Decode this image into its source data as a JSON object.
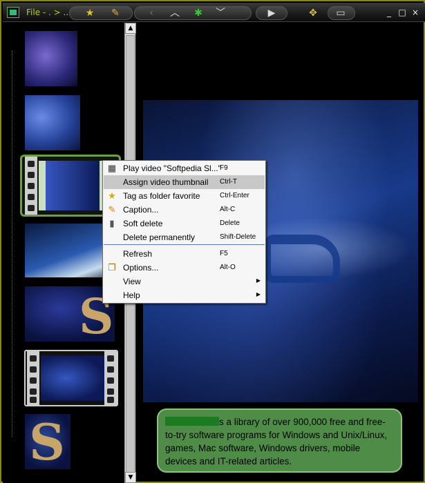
{
  "window": {
    "title": "File - . > ..."
  },
  "toolbar": {
    "star_icon": "star-icon",
    "pencil_icon": "pencil-icon",
    "back_icon": "chevron-left-icon",
    "up_icon": "chevron-up-icon",
    "bug_icon": "bug-icon",
    "down_icon": "chevron-down-icon",
    "play_icon": "play-icon",
    "move_icon": "move-icon",
    "toggle_icon": "toggle-icon"
  },
  "window_controls": {
    "minimize": "_",
    "maximize": "□",
    "close": "×"
  },
  "scrollbar": {
    "up": "▲",
    "down": "▼"
  },
  "context_menu": {
    "items": [
      {
        "label": "Play video \"Softpedia Sl...\"",
        "shortcut": "F9",
        "icon": "film-icon"
      },
      {
        "label": "Assign video thumbnail",
        "shortcut": "Ctrl-T",
        "icon": ""
      },
      {
        "label": "Tag as folder favorite",
        "shortcut": "Ctrl-Enter",
        "icon": "star-icon"
      },
      {
        "label": "Caption...",
        "shortcut": "Alt-C",
        "icon": "pencil-icon"
      },
      {
        "label": "Soft delete",
        "shortcut": "Delete",
        "icon": "trash-icon"
      },
      {
        "label": "Delete permanently",
        "shortcut": "Shift-Delete",
        "icon": ""
      },
      {
        "label": "Refresh",
        "shortcut": "F5",
        "icon": ""
      },
      {
        "label": "Options...",
        "shortcut": "Alt-O",
        "icon": "options-icon"
      },
      {
        "label": "View",
        "shortcut": "",
        "icon": ""
      },
      {
        "label": "Help",
        "shortcut": "",
        "icon": ""
      }
    ],
    "highlighted_index": 1
  },
  "caption": {
    "text": "s a library of over 900,000 free and free-to-try software programs for Windows and Unix/Linux, games, Mac software, Windows drivers, mobile devices and IT-related articles."
  }
}
